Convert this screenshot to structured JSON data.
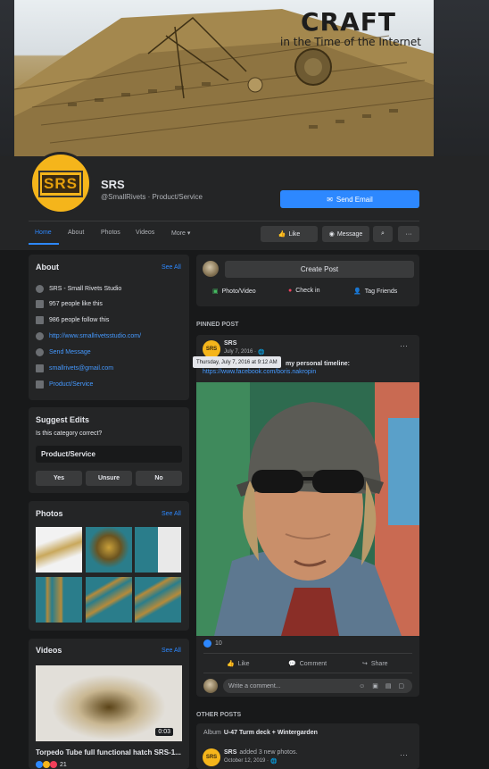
{
  "cover": {
    "title": "CRAFT",
    "subtitle": "in the Time of the Internet"
  },
  "page": {
    "logo_text": "SRS",
    "name": "SRS",
    "subtitle": "@SmallRivets · Product/Service",
    "send_email_label": "Send Email"
  },
  "nav": {
    "tabs": [
      "Home",
      "About",
      "Photos",
      "Videos",
      "More"
    ],
    "like_label": "Like",
    "message_label": "Message"
  },
  "about": {
    "title": "About",
    "see_all": "See All",
    "rows": [
      "SRS - Small Rivets Studio",
      "957 people like this",
      "986 people follow this",
      "http://www.smallrivetsstudio.com/",
      "Send Message",
      "smallrivets@gmail.com",
      "Product/Service"
    ]
  },
  "suggest": {
    "title": "Suggest Edits",
    "question": "Is this category correct?",
    "answer": "Product/Service",
    "buttons": [
      "Yes",
      "Unsure",
      "No"
    ]
  },
  "photos": {
    "title": "Photos",
    "see_all": "See All"
  },
  "videos": {
    "title": "Videos",
    "see_all": "See All",
    "duration": "0:03",
    "caption": "Torpedo Tube full functional hatch SRS-1...",
    "reactions": "21"
  },
  "composer": {
    "button": "Create Post",
    "actions": [
      "Photo/Video",
      "Check in",
      "Tag Friends"
    ]
  },
  "pinned": {
    "section": "PINNED POST",
    "author": "SRS",
    "date": "July 7, 2016 · ",
    "text_tail": "my personal timeline:",
    "link": "https://www.facebook.com/boris.nakropin",
    "tooltip": "Thursday, July 7, 2016 at 9:12 AM",
    "reaction_count": "10",
    "actions": [
      "Like",
      "Comment",
      "Share"
    ],
    "comment_placeholder": "Write a comment..."
  },
  "other": {
    "section": "OTHER POSTS",
    "album_prefix": "Album",
    "album_name": "U-47 Turm deck + Wintergarden",
    "author": "SRS",
    "action": "added 3 new photos.",
    "date": "October 12, 2019 · "
  },
  "colors": {
    "accent": "#2d88ff",
    "bg": "#18191a",
    "card": "#242526",
    "logo": "#f5b51b"
  }
}
